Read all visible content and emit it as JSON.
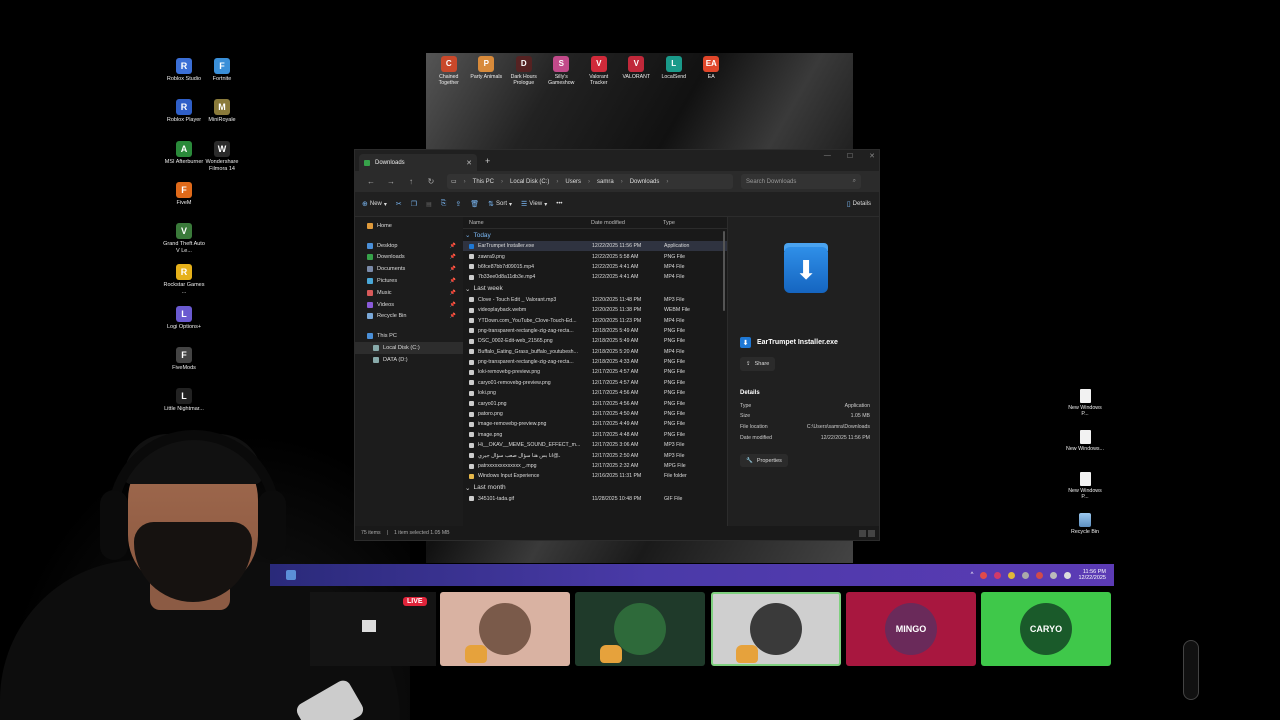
{
  "desktop_left_icons": [
    {
      "label": "Roblox Studio",
      "glyph": "R",
      "color": "#3b6fd6"
    },
    {
      "label": "Fortnite",
      "glyph": "F",
      "color": "#3a8fd8"
    },
    {
      "label": "Roblox Player",
      "glyph": "R",
      "color": "#2f5fc8"
    },
    {
      "label": "MiniRoyale",
      "glyph": "M",
      "color": "#8a7a3a"
    },
    {
      "label": "MSI Afterburner",
      "glyph": "A",
      "color": "#2a8a3a"
    },
    {
      "label": "Wondershare Filmora 14",
      "glyph": "W",
      "color": "#2b2b2b"
    },
    {
      "label": "FiveM",
      "glyph": "F",
      "color": "#e06a1a"
    },
    {
      "label": "Grand Theft Auto V Le...",
      "glyph": "V",
      "color": "#3a7a3a"
    },
    {
      "label": "Rockstar Games ...",
      "glyph": "R",
      "color": "#e6b11a"
    },
    {
      "label": "Logi Options+",
      "glyph": "L",
      "color": "#6a5ad0"
    },
    {
      "label": "FiveMods",
      "glyph": "F",
      "color": "#444"
    },
    {
      "label": "Little Nightmar...",
      "glyph": "L",
      "color": "#222"
    }
  ],
  "wallpaper_icons": [
    {
      "label": "Chained Together",
      "glyph": "C",
      "color": "#c9482a"
    },
    {
      "label": "Party Animals",
      "glyph": "P",
      "color": "#d88a3a"
    },
    {
      "label": "Dark Hours Prologue",
      "glyph": "D",
      "color": "#552222"
    },
    {
      "label": "Silly's Gameshow",
      "glyph": "S",
      "color": "#c24a8a"
    },
    {
      "label": "Valorant Tracker",
      "glyph": "V",
      "color": "#d02a3a"
    },
    {
      "label": "VALORANT",
      "glyph": "V",
      "color": "#c0283a"
    },
    {
      "label": "LocalSend",
      "glyph": "L",
      "color": "#1a9a8a"
    },
    {
      "label": "EA",
      "glyph": "EA",
      "color": "#e0462a"
    }
  ],
  "explorer": {
    "tab_title": "Downloads",
    "new_tab": "+",
    "breadcrumb": [
      "This PC",
      "Local Disk (C:)",
      "Users",
      "samra",
      "Downloads"
    ],
    "search_placeholder": "Search Downloads",
    "toolbar": {
      "new": "New",
      "sort": "Sort",
      "view": "View",
      "more": "•••",
      "details": "Details"
    },
    "sidebar": {
      "home": "Home",
      "quick": [
        {
          "label": "Desktop",
          "color": "#4a8fd8"
        },
        {
          "label": "Downloads",
          "color": "#37a24a"
        },
        {
          "label": "Documents",
          "color": "#7a8aa8"
        },
        {
          "label": "Pictures",
          "color": "#4aa8d8"
        },
        {
          "label": "Music",
          "color": "#d85a5a"
        },
        {
          "label": "Videos",
          "color": "#8a5ad8"
        },
        {
          "label": "Recycle Bin",
          "color": "#7aa8d8"
        }
      ],
      "this_pc": "This PC",
      "drives": [
        "Local Disk (C:)",
        "DATA (D:)"
      ]
    },
    "columns": {
      "name": "Name",
      "date": "Date modified",
      "type": "Type"
    },
    "groups": [
      {
        "label": "Today",
        "files": [
          {
            "name": "EarTrumpet Installer.exe",
            "date": "12/22/2025 11:56 PM",
            "type": "Application",
            "color": "#1e78d5",
            "selected": true
          },
          {
            "name": "zawra9.png",
            "date": "12/22/2025 5:58 AM",
            "type": "PNG File",
            "color": "#cccccc"
          },
          {
            "name": "b6fce87bb7d09015.mp4",
            "date": "12/22/2025 4:41 AM",
            "type": "MP4 File",
            "color": "#cccccc"
          },
          {
            "name": "7b33ee0d8a11db3e.mp4",
            "date": "12/22/2025 4:41 AM",
            "type": "MP4 File",
            "color": "#cccccc"
          }
        ]
      },
      {
        "label": "Last week",
        "files": [
          {
            "name": "Clove - Touch Edit _ Valorant.mp3",
            "date": "12/20/2025 11:48 PM",
            "type": "MP3 File",
            "color": "#cccccc"
          },
          {
            "name": "videoplayback.webm",
            "date": "12/20/2025 11:38 PM",
            "type": "WEBM File",
            "color": "#cccccc"
          },
          {
            "name": "YTDown.com_YouTube_Clove-Touch-Ed...",
            "date": "12/20/2025 11:23 PM",
            "type": "MP4 File",
            "color": "#cccccc"
          },
          {
            "name": "png-transparent-rectangle-zig-zag-recta...",
            "date": "12/18/2025 5:49 AM",
            "type": "PNG File",
            "color": "#cccccc"
          },
          {
            "name": "DSC_0002-Edit-web_21565.png",
            "date": "12/18/2025 5:49 AM",
            "type": "PNG File",
            "color": "#cccccc"
          },
          {
            "name": "Buffalo_Eating_Grass_buffalo_youtubesh...",
            "date": "12/18/2025 5:20 AM",
            "type": "MP4 File",
            "color": "#cccccc"
          },
          {
            "name": "png-transparent-rectangle-zig-zag-recta...",
            "date": "12/18/2025 4:33 AM",
            "type": "PNG File",
            "color": "#cccccc"
          },
          {
            "name": "loki-removebg-preview.png",
            "date": "12/17/2025 4:57 AM",
            "type": "PNG File",
            "color": "#cccccc"
          },
          {
            "name": "caryo01-removebg-preview.png",
            "date": "12/17/2025 4:57 AM",
            "type": "PNG File",
            "color": "#cccccc"
          },
          {
            "name": "loki.png",
            "date": "12/17/2025 4:56 AM",
            "type": "PNG File",
            "color": "#cccccc"
          },
          {
            "name": "caryo01.png",
            "date": "12/17/2025 4:56 AM",
            "type": "PNG File",
            "color": "#cccccc"
          },
          {
            "name": "patoro.png",
            "date": "12/17/2025 4:50 AM",
            "type": "PNG File",
            "color": "#cccccc"
          },
          {
            "name": "image-removebg-preview.png",
            "date": "12/17/2025 4:49 AM",
            "type": "PNG File",
            "color": "#cccccc"
          },
          {
            "name": "image.png",
            "date": "12/17/2025 4:48 AM",
            "type": "PNG File",
            "color": "#cccccc"
          },
          {
            "name": "Hi__OKAV__MEME_SOUND_EFFECT_m...",
            "date": "12/17/2025 3:06 AM",
            "type": "MP3 File",
            "color": "#cccccc"
          },
          {
            "name": "ـ@انا بس هنا سؤال صعب سؤال جيري",
            "date": "12/17/2025 2:50 AM",
            "type": "MP3 File",
            "color": "#cccccc"
          },
          {
            "name": "patrxxxxxxxxxxxxx _.mpg",
            "date": "12/17/2025 2:32 AM",
            "type": "MPG File",
            "color": "#cccccc"
          },
          {
            "name": "Windows Input Experience",
            "date": "12/16/2025 11:31 PM",
            "type": "File folder",
            "color": "#e6b84a"
          }
        ]
      },
      {
        "label": "Last month",
        "files": [
          {
            "name": "345101-tada.gif",
            "date": "11/28/2025 10:48 PM",
            "type": "GIF File",
            "color": "#cccccc"
          }
        ]
      }
    ],
    "details_pane": {
      "filename": "EarTrumpet Installer.exe",
      "share": "Share",
      "heading": "Details",
      "rows": [
        {
          "k": "Type",
          "v": "Application"
        },
        {
          "k": "Size",
          "v": "1.05 MB"
        },
        {
          "k": "File location",
          "v": "C:\\Users\\samra\\Downloads"
        },
        {
          "k": "Date modified",
          "v": "12/22/2025 11:56 PM"
        }
      ],
      "properties": "Properties"
    },
    "status": {
      "items": "75 items",
      "selected": "1 item selected  1.05 MB"
    }
  },
  "taskbar": {
    "time": "11:56 PM",
    "date": "12/22/2025"
  },
  "desktop_right_icons": [
    {
      "label": "New Windows P...",
      "kind": "doc"
    },
    {
      "label": "New Windows...",
      "kind": "doc"
    },
    {
      "label": "New Windows P...",
      "kind": "doc"
    },
    {
      "label": "Recycle Bin",
      "kind": "bin"
    }
  ],
  "stream_overlay": {
    "live_label": "LIVE",
    "cards": [
      {
        "bg": "#d9b2a2",
        "avatar": "#7a5a4a",
        "label": ""
      },
      {
        "bg": "#1f3a2a",
        "avatar": "#2e6a3a",
        "label": ""
      },
      {
        "bg": "#cfcfcf",
        "avatar": "#3a3a3a",
        "label": ""
      },
      {
        "bg": "#a8173f",
        "avatar": "#6a2a5a",
        "label": "MINGO"
      },
      {
        "bg": "#3fc84a",
        "avatar": "#1a5a2a",
        "label": "CARYO"
      }
    ]
  }
}
